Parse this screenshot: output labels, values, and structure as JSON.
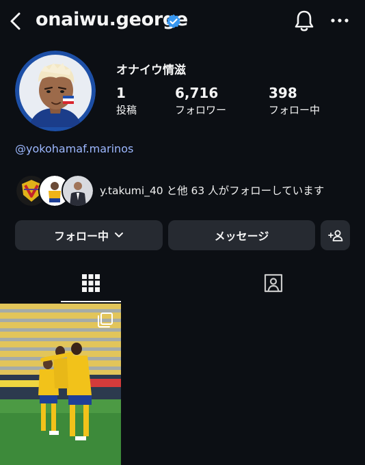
{
  "header": {
    "username": "onaiwu.george",
    "verified": true,
    "back_icon": "chevron-left-icon",
    "bell_icon": "bell-icon",
    "more_icon": "more-horizontal-icon"
  },
  "profile": {
    "full_name": "オナイウ情滋",
    "stats": [
      {
        "value": "1",
        "label": "投稿"
      },
      {
        "value": "6,716",
        "label": "フォロワー"
      },
      {
        "value": "398",
        "label": "フォロー中"
      }
    ],
    "link": "@yokohamaf.marinos",
    "followed_by": "y.takumi_40 と他 63 人がフォローしています"
  },
  "actions": {
    "following_label": "フォロー中",
    "message_label": "メッセージ",
    "add_user_icon": "add-person-icon"
  },
  "tabs": [
    {
      "icon": "grid-icon",
      "active": true
    },
    {
      "icon": "tagged-icon",
      "active": false
    }
  ],
  "colors": {
    "background": "#0c0f14",
    "button": "#262a31",
    "link": "#9db8ff",
    "verified": "#3897f0"
  }
}
